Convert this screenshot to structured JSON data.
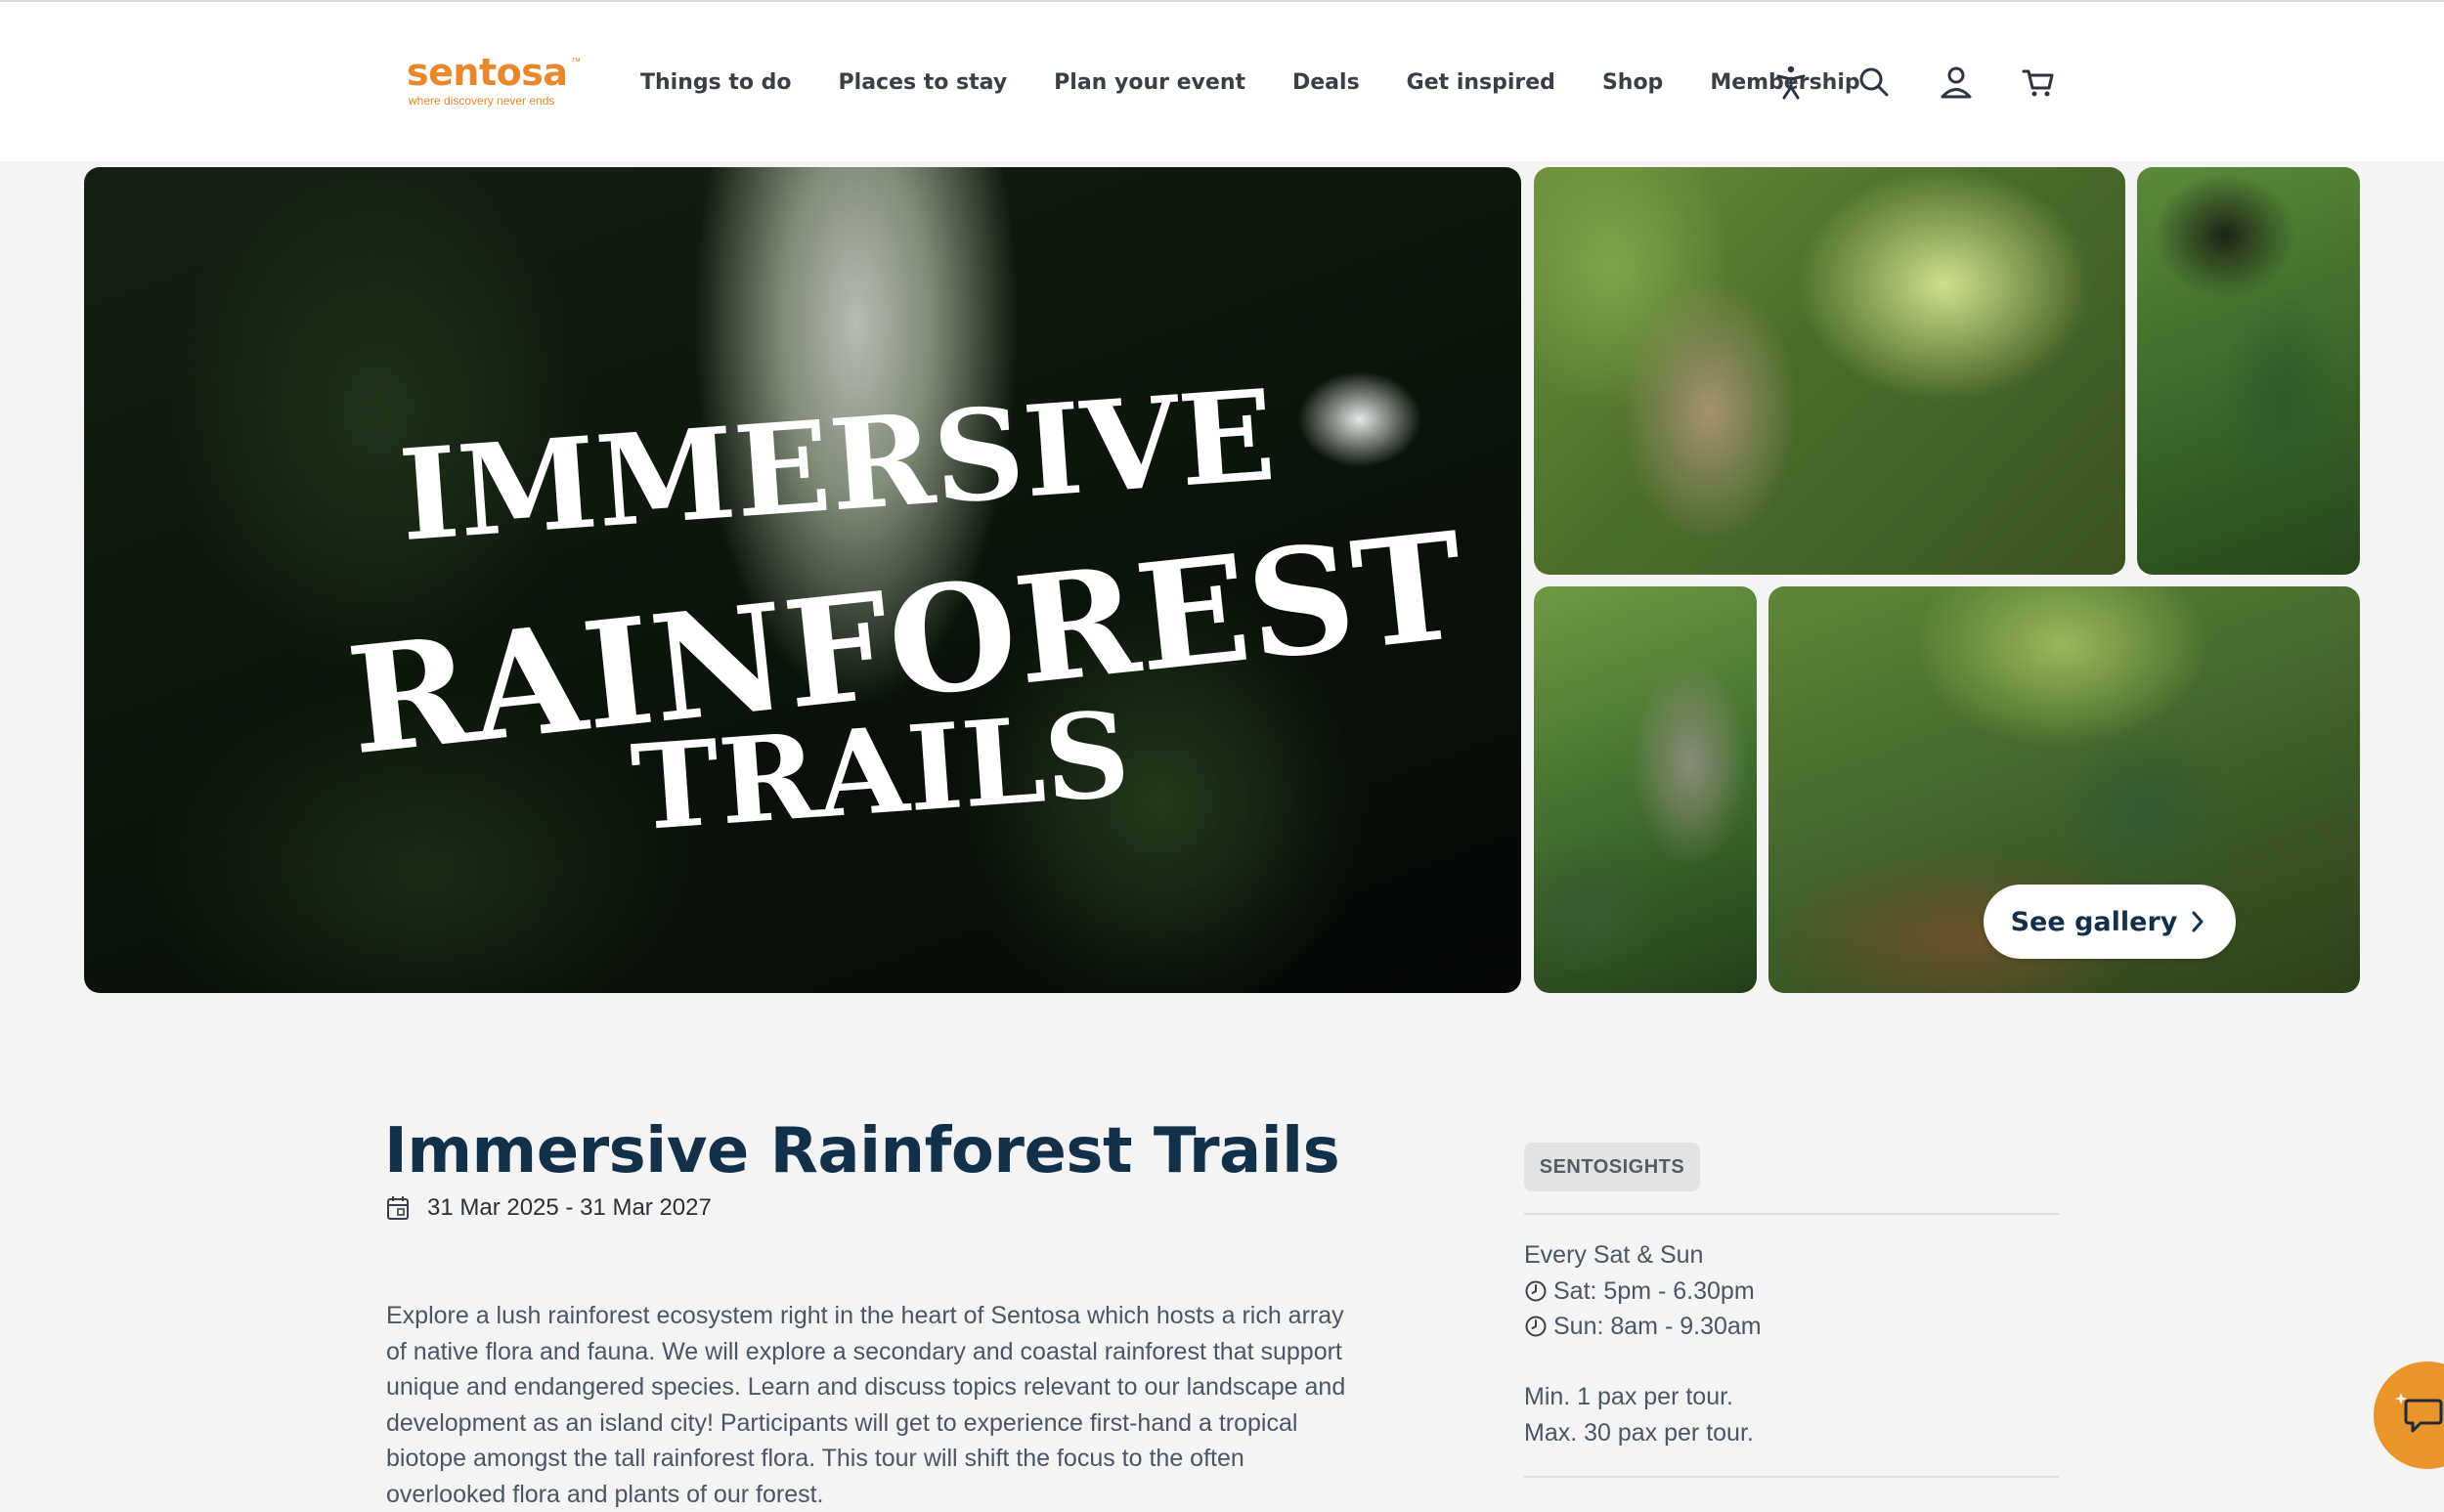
{
  "header": {
    "logo": {
      "word": "sentosa",
      "tagline": "where discovery never ends",
      "tm": "™"
    },
    "nav": [
      {
        "label": "Things to do"
      },
      {
        "label": "Places to stay"
      },
      {
        "label": "Plan your event"
      },
      {
        "label": "Deals"
      },
      {
        "label": "Get inspired"
      },
      {
        "label": "Shop"
      },
      {
        "label": "Membership"
      }
    ],
    "icons": [
      "accessibility-icon",
      "search-icon",
      "user-icon",
      "cart-icon"
    ]
  },
  "gallery": {
    "hero_title_lines": [
      "IMMERSIVE",
      "RAINFOREST",
      "TRAILS"
    ],
    "see_gallery_label": "See gallery"
  },
  "event": {
    "title": "Immersive Rainforest Trails",
    "date_range": "31 Mar 2025 - 31 Mar 2027",
    "description": "Explore a lush rainforest ecosystem right in the heart of Sentosa which hosts a rich array of native flora and fauna. We will explore a secondary and coastal rainforest that support unique and endangered species. Learn and discuss topics relevant to our landscape and development as an island city! Participants will get to experience first-hand a tropical biotope amongst the tall rainforest flora. This tour will shift the focus to the often overlooked flora and plants of our forest."
  },
  "sidebar": {
    "tag": "SENTOSIGHTS",
    "schedule_heading": "Every Sat & Sun",
    "times": [
      {
        "label": "Sat:  5pm - 6.30pm"
      },
      {
        "label": "Sun:  8am - 9.30am"
      }
    ],
    "pax_min": "Min. 1 pax per tour.",
    "pax_max": "Max. 30 pax per tour."
  },
  "colors": {
    "brand_orange": "#e8882a",
    "heading_navy": "#12304a",
    "body_text": "#4a5565",
    "chat_button": "#e9952b"
  }
}
